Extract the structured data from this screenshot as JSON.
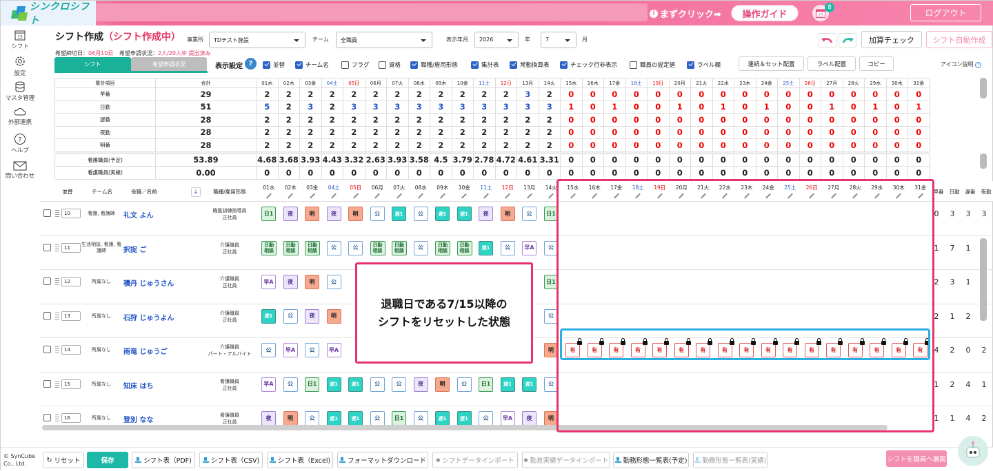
{
  "app": {
    "logo": "シンクロシフト",
    "guide_text": "まずクリック➡",
    "guide_button": "操作ガイド",
    "calendar_day": "15",
    "notification_count": "8",
    "logout": "ログアウト"
  },
  "sidebar": [
    {
      "label": "シフト",
      "icon": "calendar-icon"
    },
    {
      "label": "設定",
      "icon": "gear-icon"
    },
    {
      "label": "マスタ管理",
      "icon": "database-icon"
    },
    {
      "label": "外部連携",
      "icon": "cloud-icon"
    },
    {
      "label": "ヘルプ",
      "icon": "help-icon"
    },
    {
      "label": "問い合わせ",
      "icon": "mail-icon"
    }
  ],
  "header": {
    "title": "シフト作成",
    "status": "（シフト作成中）",
    "office_label": "事業所",
    "office_value": "TDテスト施設",
    "team_label": "チーム",
    "team_value": "全職員",
    "year_month_label": "表示年月",
    "year_value": "2026",
    "year_unit": "年",
    "month_value": "7",
    "month_unit": "月",
    "deadline_label": "希望締切日：",
    "deadline_value": "06月10日",
    "submit_label": "希望申請状況：",
    "submit_value": "2人/20人中 提出済み",
    "calc_check": "加算チェック",
    "auto_create": "シフト自動作成"
  },
  "tabs": {
    "shift": "シフト",
    "wish": "希望申請状況"
  },
  "display_settings": {
    "label": "表示設定",
    "help": "?",
    "options": [
      {
        "label": "並替",
        "checked": true
      },
      {
        "label": "チーム名",
        "checked": true
      },
      {
        "label": "フラグ",
        "checked": false
      },
      {
        "label": "資格",
        "checked": false
      },
      {
        "label": "職種/雇用形態",
        "checked": true
      },
      {
        "label": "集計表",
        "checked": true
      },
      {
        "label": "常勤換算表",
        "checked": true
      },
      {
        "label": "チェック行非表示",
        "checked": true
      },
      {
        "label": "職員の設定値",
        "checked": false
      },
      {
        "label": "ラベル欄",
        "checked": true
      }
    ],
    "buttons": [
      "連続＆セット配置",
      "ラベル配置",
      "コピー"
    ],
    "icon_legend": "アイコン説明"
  },
  "days": [
    "01水",
    "02木",
    "03金",
    "04土",
    "05日",
    "06月",
    "07火",
    "08水",
    "09木",
    "10金",
    "11土",
    "12日",
    "13月",
    "14火",
    "15水",
    "16木",
    "17金",
    "18土",
    "19日",
    "20月",
    "21火",
    "22水",
    "23木",
    "24金",
    "25土",
    "26日",
    "27月",
    "28火",
    "29水",
    "30木",
    "31金"
  ],
  "summary": {
    "header_item": "集計項目",
    "header_total": "合計",
    "rows": [
      {
        "label": "早番",
        "total": "29",
        "values": [
          "2",
          "2",
          "2",
          "2",
          "2",
          "2",
          "2",
          "2",
          "2",
          "2",
          "2",
          "2",
          "3",
          "2",
          "0",
          "0",
          "0",
          "0",
          "0",
          "0",
          "0",
          "0",
          "0",
          "0",
          "0",
          "0",
          "0",
          "0",
          "0",
          "0",
          "0"
        ]
      },
      {
        "label": "日勤",
        "total": "51",
        "values": [
          "5",
          "2",
          "3",
          "2",
          "3",
          "3",
          "3",
          "3",
          "3",
          "3",
          "3",
          "3",
          "3",
          "3",
          "1",
          "0",
          "1",
          "0",
          "0",
          "1",
          "0",
          "1",
          "0",
          "1",
          "0",
          "0",
          "1",
          "0",
          "1",
          "0",
          "1"
        ]
      },
      {
        "label": "遅番",
        "total": "28",
        "values": [
          "2",
          "2",
          "2",
          "2",
          "2",
          "2",
          "2",
          "2",
          "2",
          "2",
          "2",
          "2",
          "2",
          "2",
          "0",
          "0",
          "0",
          "0",
          "0",
          "0",
          "0",
          "0",
          "0",
          "0",
          "0",
          "0",
          "0",
          "0",
          "0",
          "0",
          "0"
        ]
      },
      {
        "label": "夜勤",
        "total": "28",
        "values": [
          "2",
          "2",
          "2",
          "2",
          "2",
          "2",
          "2",
          "2",
          "2",
          "2",
          "2",
          "2",
          "2",
          "2",
          "0",
          "0",
          "0",
          "0",
          "0",
          "0",
          "0",
          "0",
          "0",
          "0",
          "0",
          "0",
          "0",
          "0",
          "0",
          "0",
          "0"
        ]
      },
      {
        "label": "明番",
        "total": "28",
        "values": [
          "2",
          "2",
          "2",
          "2",
          "2",
          "2",
          "2",
          "2",
          "2",
          "2",
          "2",
          "2",
          "2",
          "2",
          "0",
          "0",
          "0",
          "0",
          "0",
          "0",
          "0",
          "0",
          "0",
          "0",
          "0",
          "0",
          "0",
          "0",
          "0",
          "0",
          "0"
        ]
      }
    ],
    "fte_rows": [
      {
        "label": "看護職員(予定)",
        "total": "53.89",
        "values": [
          "4.68",
          "3.68",
          "3.93",
          "4.43",
          "3.32",
          "2.63",
          "3.93",
          "3.58",
          "4.5",
          "3.79",
          "2.78",
          "4.72",
          "4.61",
          "3.31",
          "0",
          "0",
          "0",
          "0",
          "0",
          "0",
          "0",
          "0",
          "0",
          "0",
          "0",
          "0",
          "0",
          "0",
          "0",
          "0",
          "0"
        ]
      },
      {
        "label": "看護職員(実績)",
        "total": "0.00",
        "values": [
          "0",
          "0",
          "0",
          "0",
          "0",
          "0",
          "0",
          "0",
          "0",
          "0",
          "0",
          "0",
          "0",
          "0",
          "0",
          "0",
          "0",
          "0",
          "0",
          "0",
          "0",
          "0",
          "0",
          "0",
          "0",
          "0",
          "0",
          "0",
          "0",
          "0",
          "0"
        ]
      }
    ]
  },
  "staff_header": {
    "order": "並替",
    "team": "チーム名",
    "name": "役職／名前",
    "job": "職種/雇用形態",
    "sum_cols": [
      "早番",
      "日勤",
      "遅番",
      "夜勤"
    ]
  },
  "staff": [
    {
      "order": "10",
      "team": "看護, 看護師",
      "name": "礼文 よん",
      "job": "機能訓練指導員\n正社員",
      "shifts": [
        "日1",
        "夜",
        "明",
        "夜",
        "明",
        "公",
        "遅1",
        "公",
        "遅1",
        "遅1",
        "夜",
        "明",
        "公",
        "日1"
      ],
      "sums": [
        "0",
        "3",
        "3",
        "3"
      ]
    },
    {
      "order": "11",
      "team": "生活相談, 看護, 看護師",
      "name": "択捉 ご",
      "job": "介護職員\n正社員",
      "shifts": [
        "日勤相談",
        "日勤相談",
        "日勤相談",
        "公",
        "公",
        "日勤相談",
        "日勤相談",
        "公",
        "日勤相談",
        "日勤相談",
        "遅1",
        "公",
        "早A",
        "公"
      ],
      "sums": [
        "1",
        "7",
        "1",
        "1"
      ]
    },
    {
      "order": "12",
      "team": "所属なし",
      "name": "積丹 じゅうさん",
      "job": "介護職員\n正社員",
      "shifts": [
        "早A",
        "夜",
        "明",
        "公",
        "",
        "",
        "",
        "",
        "",
        "",
        "",
        "",
        "",
        "日1"
      ],
      "sums": [
        "2",
        "3",
        "1",
        "1"
      ]
    },
    {
      "order": "13",
      "team": "所属なし",
      "name": "石狩 じゅうよん",
      "job": "介護職員\n正社員",
      "shifts": [
        "遅1",
        "公",
        "夜",
        "明",
        "",
        "",
        "",
        "",
        "",
        "",
        "",
        "",
        "",
        "公"
      ],
      "sums": [
        "2",
        "1",
        "2",
        "2"
      ]
    },
    {
      "order": "14",
      "team": "所属なし",
      "name": "雨竜 じゅうご",
      "job": "介護職員\nパート・アルバイト",
      "shifts": [
        "公",
        "早A",
        "公",
        "早A",
        "",
        "",
        "",
        "",
        "",
        "",
        "",
        "",
        "",
        "明"
      ],
      "sums": [
        "4",
        "2",
        "0",
        "2"
      ],
      "later": "有"
    },
    {
      "order": "15",
      "team": "所属なし",
      "name": "知床 はち",
      "job": "看護職員\n正社員",
      "shifts": [
        "早A",
        "公",
        "日1",
        "遅1",
        "遅1",
        "公",
        "公",
        "夜",
        "明",
        "公",
        "日1",
        "遅1",
        "遅1",
        "公"
      ],
      "sums": [
        "1",
        "2",
        "4",
        "1"
      ]
    },
    {
      "order": "16",
      "team": "所属なし",
      "name": "登別 なな",
      "job": "看護職員\n正社員",
      "shifts": [
        "夜",
        "明",
        "公",
        "遅1",
        "遅1",
        "公",
        "日1",
        "公",
        "遅1",
        "遅1",
        "公",
        "早A",
        "夜",
        "明"
      ],
      "sums": [
        "1",
        "1",
        "4",
        "2"
      ]
    }
  ],
  "callout": {
    "line1": "退職日である7/15以降の",
    "line2": "シフトをリセットした状態"
  },
  "footer": {
    "copyright": "© SynCube Co., Ltd.",
    "buttons": [
      "リセット",
      "保存",
      "シフト表（PDF)",
      "シフト表（CSV)",
      "シフト表（Excel)",
      "フォーマットダウンロード",
      "シフトデータインポート",
      "勤怠実績データインポート",
      "勤務形態一覧表(予定)",
      "勤務形態一覧表(実績)"
    ],
    "publish": "シフトを職員へ展開"
  }
}
